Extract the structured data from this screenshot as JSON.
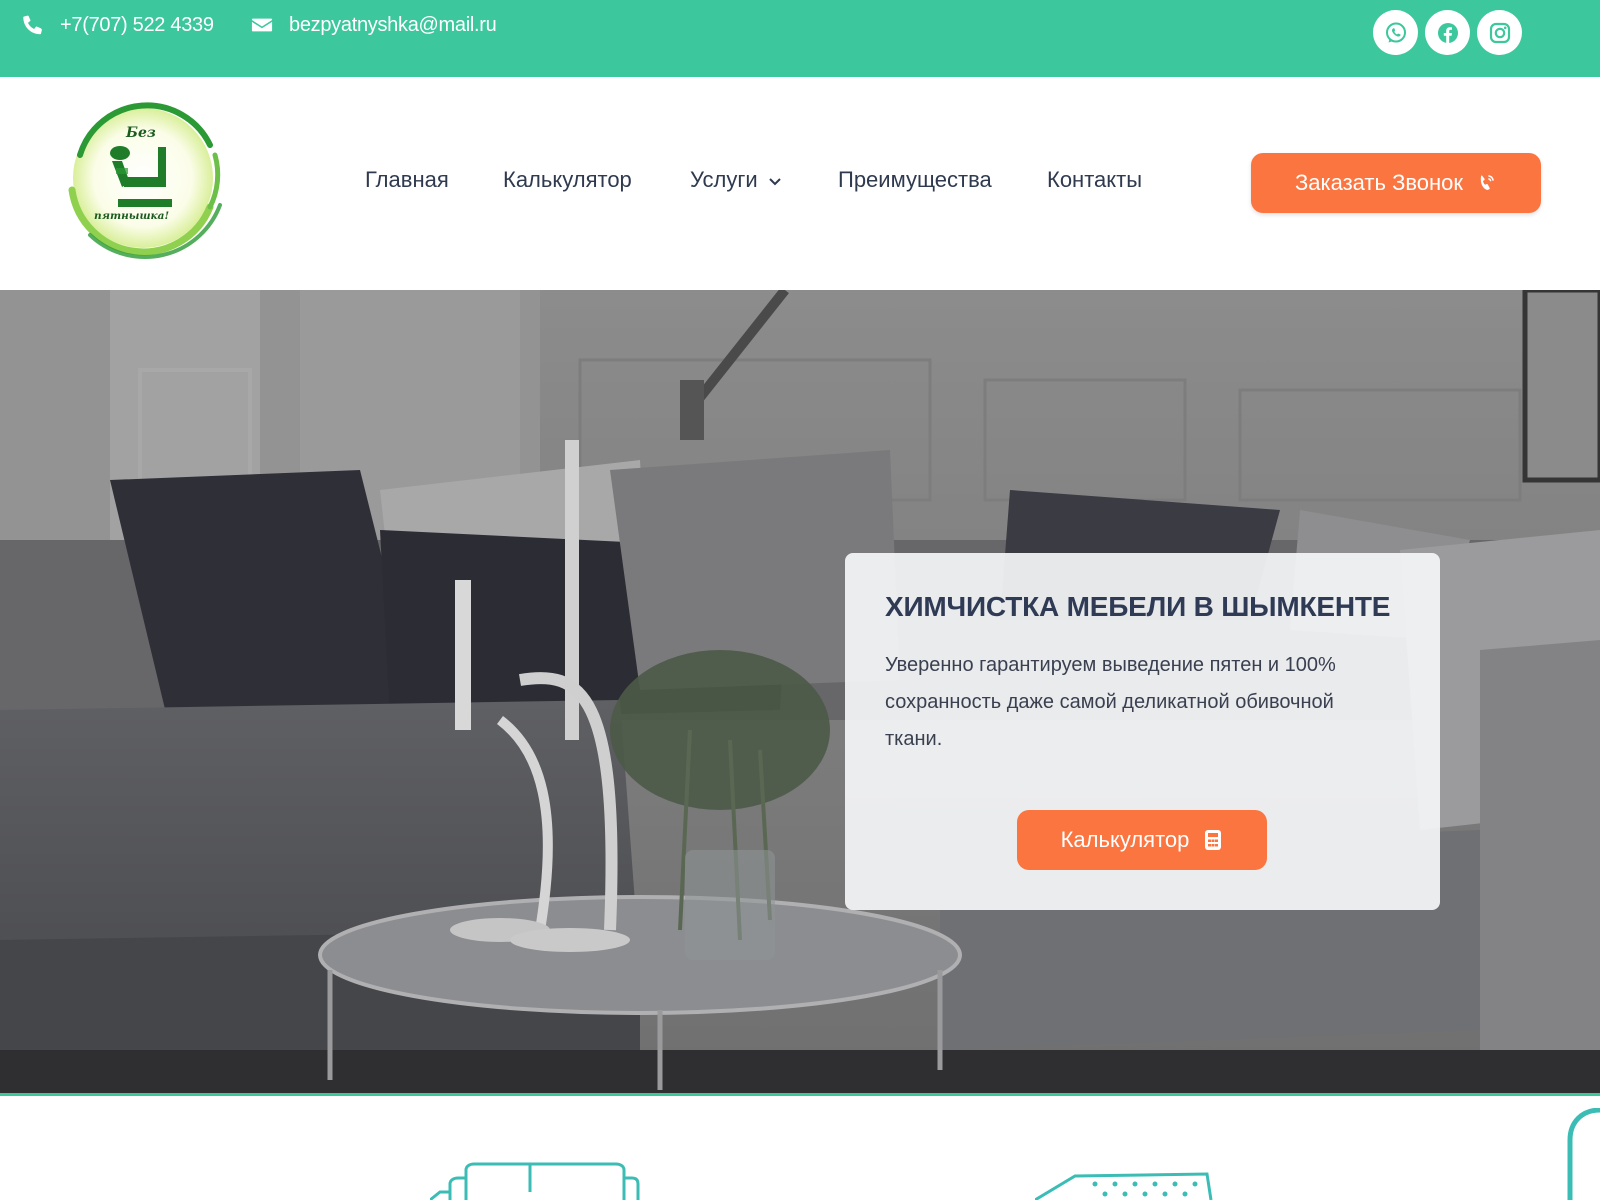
{
  "topbar": {
    "phone": "+7(707) 522 4339",
    "email": "bezpyatnyshka@mail.ru",
    "socials": [
      "whatsapp-icon",
      "facebook-icon",
      "instagram-icon"
    ],
    "background_color": "#3cc79d"
  },
  "logo": {
    "line1": "Без",
    "line2": "пятнышка!"
  },
  "nav": {
    "items": [
      {
        "label": "Главная"
      },
      {
        "label": "Калькулятор"
      },
      {
        "label": "Услуги",
        "has_dropdown": true
      },
      {
        "label": "Преимущества"
      },
      {
        "label": "Контакты"
      }
    ]
  },
  "header": {
    "call_button_label": "Заказать Звонок",
    "call_button_icon": "phone-volume-icon",
    "accent_color": "#fb7540"
  },
  "hero": {
    "title": "ХИМЧИСТКА МЕБЕЛИ В ШЫМКЕНТЕ",
    "text": "Уверенно гарантируем выведение пятен и 100% сохранность даже самой деликатной обивочной ткани.",
    "button_label": "Калькулятор",
    "button_icon": "calculator-icon"
  },
  "features": {
    "icons": [
      "sofa-icon",
      "mattress-icon"
    ]
  }
}
